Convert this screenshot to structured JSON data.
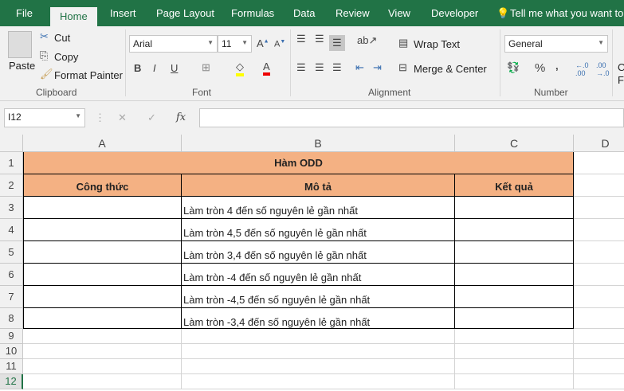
{
  "tabs": [
    "File",
    "Home",
    "Insert",
    "Page Layout",
    "Formulas",
    "Data",
    "Review",
    "View",
    "Developer"
  ],
  "tell_me": "Tell me what you want to do",
  "clipboard": {
    "paste": "Paste",
    "cut": "Cut",
    "copy": "Copy",
    "format_painter": "Format Painter",
    "label": "Clipboard"
  },
  "font": {
    "name": "Arial",
    "size": "11",
    "label": "Font",
    "bold": "B",
    "italic": "I",
    "underline": "U",
    "color_a": "A"
  },
  "alignment": {
    "wrap": "Wrap Text",
    "merge": "Merge & Center",
    "label": "Alignment"
  },
  "number": {
    "format": "General",
    "label": "Number",
    "percent": "%",
    "comma": ","
  },
  "styles_partial": [
    "C",
    "Fo"
  ],
  "formula_bar": {
    "name_box": "I12",
    "fx": "fx",
    "value": ""
  },
  "columns": [
    "A",
    "B",
    "C",
    "D"
  ],
  "rows": [
    "1",
    "2",
    "3",
    "4",
    "5",
    "6",
    "7",
    "8",
    "9",
    "10",
    "11",
    "12"
  ],
  "sheet": {
    "title": "Hàm ODD",
    "headers": [
      "Công thức",
      "Mô tả",
      "Kết quả"
    ],
    "descriptions": [
      "Làm tròn 4 đến số nguyên lẻ gần nhất",
      "Làm tròn 4,5 đến số nguyên lẻ gần nhất",
      "Làm tròn 3,4 đến số nguyên lẻ gần nhất",
      "Làm tròn -4 đến số nguyên lẻ gần nhất",
      "Làm tròn -4,5 đến số nguyên lẻ gần nhất",
      "Làm tròn -3,4 đến số nguyên lẻ gần nhất"
    ]
  },
  "colors": {
    "brand": "#217346",
    "header_fill": "#f4b183"
  }
}
